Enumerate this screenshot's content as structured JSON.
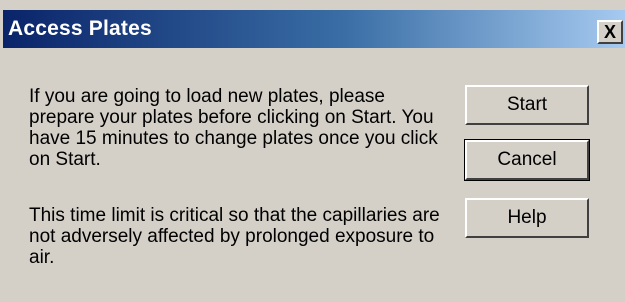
{
  "window": {
    "title": "Access Plates",
    "close_label": "X"
  },
  "message": {
    "paragraph1": "If you are going to load new plates, please prepare your plates before clicking on Start. You have 15 minutes to change plates once you click on Start.",
    "paragraph2": "This time limit is critical so that the capillaries are not adversely affected by prolonged exposure to air."
  },
  "buttons": {
    "start": "Start",
    "cancel": "Cancel",
    "help": "Help"
  }
}
